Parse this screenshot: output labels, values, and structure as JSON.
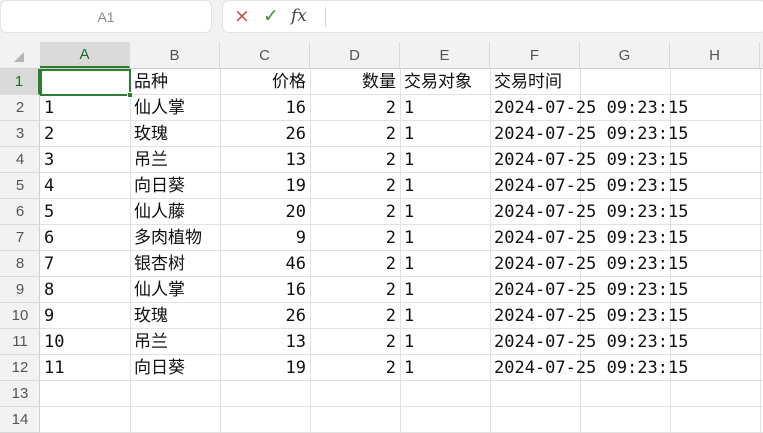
{
  "formula_bar": {
    "name_box": "A1",
    "cancel_icon": "×",
    "enter_icon": "✓",
    "fx_label": "fx",
    "formula_value": ""
  },
  "columns": [
    "A",
    "B",
    "C",
    "D",
    "E",
    "F",
    "G",
    "H"
  ],
  "selected_cell": {
    "column": "A",
    "row": 1
  },
  "rows": [
    [
      "",
      "品种",
      "价格",
      "数量",
      "交易对象",
      "交易时间"
    ],
    [
      "1",
      "仙人掌",
      "16",
      "2",
      "1",
      "2024-07-25 09:23:15"
    ],
    [
      "2",
      "玫瑰",
      "26",
      "2",
      "1",
      "2024-07-25 09:23:15"
    ],
    [
      "3",
      "吊兰",
      "13",
      "2",
      "1",
      "2024-07-25 09:23:15"
    ],
    [
      "4",
      "向日葵",
      "19",
      "2",
      "1",
      "2024-07-25 09:23:15"
    ],
    [
      "5",
      "仙人藤",
      "20",
      "2",
      "1",
      "2024-07-25 09:23:15"
    ],
    [
      "6",
      "多肉植物",
      "9",
      "2",
      "1",
      "2024-07-25 09:23:15"
    ],
    [
      "7",
      "银杏树",
      "46",
      "2",
      "1",
      "2024-07-25 09:23:15"
    ],
    [
      "8",
      "仙人掌",
      "16",
      "2",
      "1",
      "2024-07-25 09:23:15"
    ],
    [
      "9",
      "玫瑰",
      "26",
      "2",
      "1",
      "2024-07-25 09:23:15"
    ],
    [
      "10",
      "吊兰",
      "13",
      "2",
      "1",
      "2024-07-25 09:23:15"
    ],
    [
      "11",
      "向日葵",
      "19",
      "2",
      "1",
      "2024-07-25 09:23:15"
    ],
    [
      "",
      "",
      "",
      "",
      "",
      ""
    ],
    [
      "",
      "",
      "",
      "",
      "",
      ""
    ]
  ],
  "numeric_columns": [
    2,
    3
  ],
  "colors": {
    "selection": "#2e7d32",
    "cancel": "#c0504d",
    "enter": "#3f8f3a",
    "header_bg": "#f2f2f2"
  }
}
